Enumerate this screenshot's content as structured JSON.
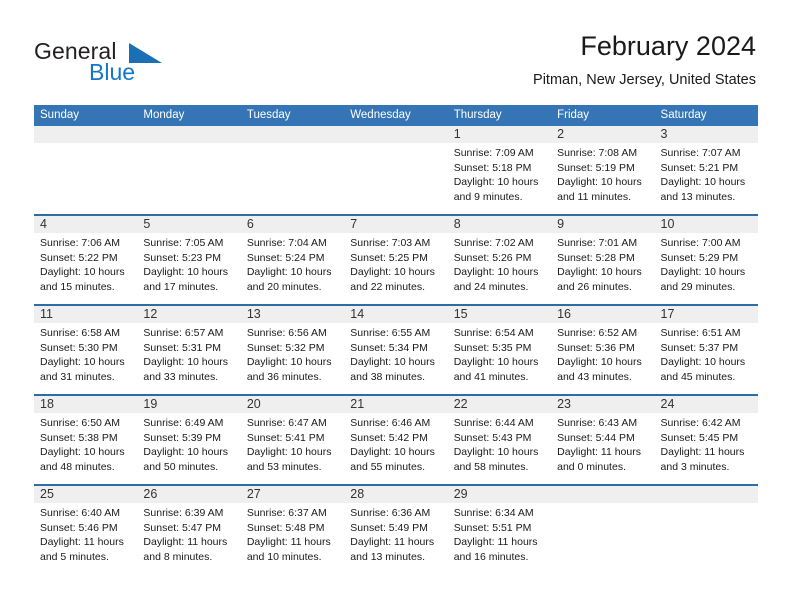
{
  "brand": {
    "name_top": "General",
    "name_bottom": "Blue",
    "accent_color": "#1b6fb5"
  },
  "header": {
    "title": "February 2024",
    "subtitle": "Pitman, New Jersey, United States"
  },
  "theme": {
    "header_blue": "#3575b5",
    "rule_blue": "#2e6da4",
    "daynum_band": "#efefef"
  },
  "weekdays": [
    "Sunday",
    "Monday",
    "Tuesday",
    "Wednesday",
    "Thursday",
    "Friday",
    "Saturday"
  ],
  "weeks": [
    [
      {
        "day": "",
        "lines": []
      },
      {
        "day": "",
        "lines": []
      },
      {
        "day": "",
        "lines": []
      },
      {
        "day": "",
        "lines": []
      },
      {
        "day": "1",
        "lines": [
          "Sunrise: 7:09 AM",
          "Sunset: 5:18 PM",
          "Daylight: 10 hours",
          "and 9 minutes."
        ]
      },
      {
        "day": "2",
        "lines": [
          "Sunrise: 7:08 AM",
          "Sunset: 5:19 PM",
          "Daylight: 10 hours",
          "and 11 minutes."
        ]
      },
      {
        "day": "3",
        "lines": [
          "Sunrise: 7:07 AM",
          "Sunset: 5:21 PM",
          "Daylight: 10 hours",
          "and 13 minutes."
        ]
      }
    ],
    [
      {
        "day": "4",
        "lines": [
          "Sunrise: 7:06 AM",
          "Sunset: 5:22 PM",
          "Daylight: 10 hours",
          "and 15 minutes."
        ]
      },
      {
        "day": "5",
        "lines": [
          "Sunrise: 7:05 AM",
          "Sunset: 5:23 PM",
          "Daylight: 10 hours",
          "and 17 minutes."
        ]
      },
      {
        "day": "6",
        "lines": [
          "Sunrise: 7:04 AM",
          "Sunset: 5:24 PM",
          "Daylight: 10 hours",
          "and 20 minutes."
        ]
      },
      {
        "day": "7",
        "lines": [
          "Sunrise: 7:03 AM",
          "Sunset: 5:25 PM",
          "Daylight: 10 hours",
          "and 22 minutes."
        ]
      },
      {
        "day": "8",
        "lines": [
          "Sunrise: 7:02 AM",
          "Sunset: 5:26 PM",
          "Daylight: 10 hours",
          "and 24 minutes."
        ]
      },
      {
        "day": "9",
        "lines": [
          "Sunrise: 7:01 AM",
          "Sunset: 5:28 PM",
          "Daylight: 10 hours",
          "and 26 minutes."
        ]
      },
      {
        "day": "10",
        "lines": [
          "Sunrise: 7:00 AM",
          "Sunset: 5:29 PM",
          "Daylight: 10 hours",
          "and 29 minutes."
        ]
      }
    ],
    [
      {
        "day": "11",
        "lines": [
          "Sunrise: 6:58 AM",
          "Sunset: 5:30 PM",
          "Daylight: 10 hours",
          "and 31 minutes."
        ]
      },
      {
        "day": "12",
        "lines": [
          "Sunrise: 6:57 AM",
          "Sunset: 5:31 PM",
          "Daylight: 10 hours",
          "and 33 minutes."
        ]
      },
      {
        "day": "13",
        "lines": [
          "Sunrise: 6:56 AM",
          "Sunset: 5:32 PM",
          "Daylight: 10 hours",
          "and 36 minutes."
        ]
      },
      {
        "day": "14",
        "lines": [
          "Sunrise: 6:55 AM",
          "Sunset: 5:34 PM",
          "Daylight: 10 hours",
          "and 38 minutes."
        ]
      },
      {
        "day": "15",
        "lines": [
          "Sunrise: 6:54 AM",
          "Sunset: 5:35 PM",
          "Daylight: 10 hours",
          "and 41 minutes."
        ]
      },
      {
        "day": "16",
        "lines": [
          "Sunrise: 6:52 AM",
          "Sunset: 5:36 PM",
          "Daylight: 10 hours",
          "and 43 minutes."
        ]
      },
      {
        "day": "17",
        "lines": [
          "Sunrise: 6:51 AM",
          "Sunset: 5:37 PM",
          "Daylight: 10 hours",
          "and 45 minutes."
        ]
      }
    ],
    [
      {
        "day": "18",
        "lines": [
          "Sunrise: 6:50 AM",
          "Sunset: 5:38 PM",
          "Daylight: 10 hours",
          "and 48 minutes."
        ]
      },
      {
        "day": "19",
        "lines": [
          "Sunrise: 6:49 AM",
          "Sunset: 5:39 PM",
          "Daylight: 10 hours",
          "and 50 minutes."
        ]
      },
      {
        "day": "20",
        "lines": [
          "Sunrise: 6:47 AM",
          "Sunset: 5:41 PM",
          "Daylight: 10 hours",
          "and 53 minutes."
        ]
      },
      {
        "day": "21",
        "lines": [
          "Sunrise: 6:46 AM",
          "Sunset: 5:42 PM",
          "Daylight: 10 hours",
          "and 55 minutes."
        ]
      },
      {
        "day": "22",
        "lines": [
          "Sunrise: 6:44 AM",
          "Sunset: 5:43 PM",
          "Daylight: 10 hours",
          "and 58 minutes."
        ]
      },
      {
        "day": "23",
        "lines": [
          "Sunrise: 6:43 AM",
          "Sunset: 5:44 PM",
          "Daylight: 11 hours",
          "and 0 minutes."
        ]
      },
      {
        "day": "24",
        "lines": [
          "Sunrise: 6:42 AM",
          "Sunset: 5:45 PM",
          "Daylight: 11 hours",
          "and 3 minutes."
        ]
      }
    ],
    [
      {
        "day": "25",
        "lines": [
          "Sunrise: 6:40 AM",
          "Sunset: 5:46 PM",
          "Daylight: 11 hours",
          "and 5 minutes."
        ]
      },
      {
        "day": "26",
        "lines": [
          "Sunrise: 6:39 AM",
          "Sunset: 5:47 PM",
          "Daylight: 11 hours",
          "and 8 minutes."
        ]
      },
      {
        "day": "27",
        "lines": [
          "Sunrise: 6:37 AM",
          "Sunset: 5:48 PM",
          "Daylight: 11 hours",
          "and 10 minutes."
        ]
      },
      {
        "day": "28",
        "lines": [
          "Sunrise: 6:36 AM",
          "Sunset: 5:49 PM",
          "Daylight: 11 hours",
          "and 13 minutes."
        ]
      },
      {
        "day": "29",
        "lines": [
          "Sunrise: 6:34 AM",
          "Sunset: 5:51 PM",
          "Daylight: 11 hours",
          "and 16 minutes."
        ]
      },
      {
        "day": "",
        "lines": []
      },
      {
        "day": "",
        "lines": []
      }
    ]
  ]
}
